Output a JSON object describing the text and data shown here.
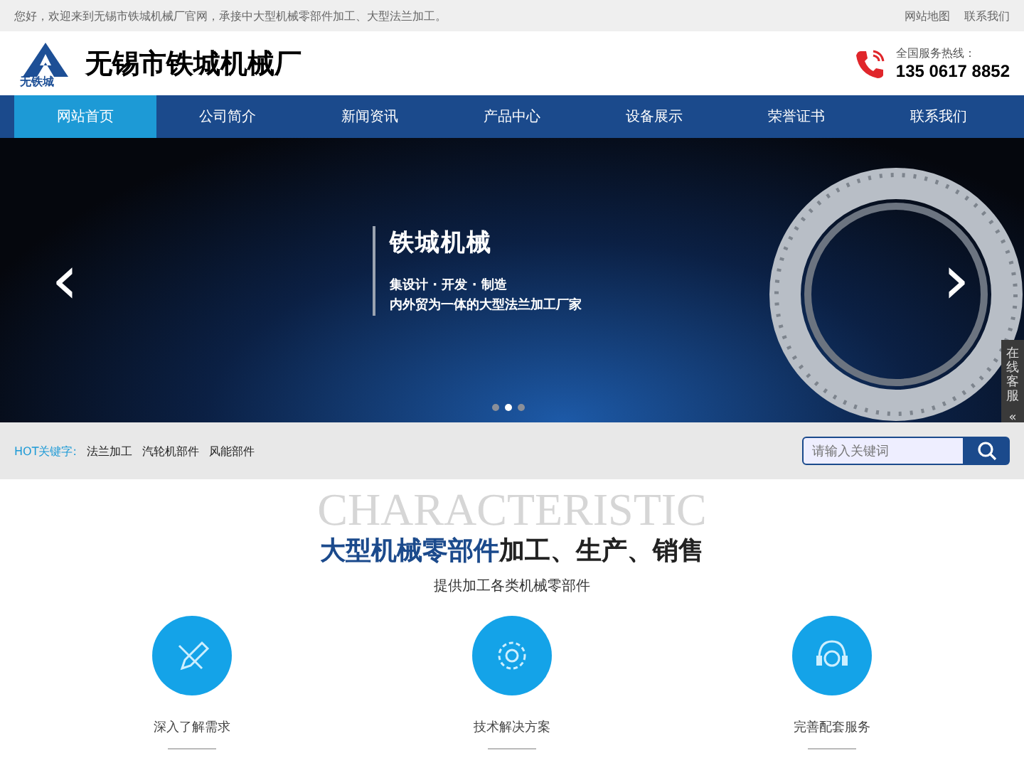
{
  "top_bar": {
    "welcome": "您好，欢迎来到无锡市铁城机械厂官网，承接中大型机械零部件加工、大型法兰加工。",
    "links": [
      "网站地图",
      "联系我们"
    ]
  },
  "header": {
    "logo_text": "无铁城",
    "company": "无锡市铁城机械厂",
    "hotline_label": "全国服务热线：",
    "hotline": "135 0617 8852"
  },
  "nav": [
    {
      "label": "网站首页",
      "selected": true
    },
    {
      "label": "公司简介",
      "selected": false
    },
    {
      "label": "新闻资讯",
      "selected": false
    },
    {
      "label": "产品中心",
      "selected": false
    },
    {
      "label": "设备展示",
      "selected": false
    },
    {
      "label": "荣誉证书",
      "selected": false
    },
    {
      "label": "联系我们",
      "selected": false
    }
  ],
  "banner": {
    "title": "铁城机械",
    "line1": "集设计 · 开发 · 制造",
    "line2": "内外贸为一体的大型法兰加工厂家",
    "prev": "‹",
    "next": "›",
    "dots": [
      {
        "selected": false
      },
      {
        "selected": true
      },
      {
        "selected": false
      }
    ]
  },
  "side_service": {
    "label": "在线客服",
    "arrow": "«"
  },
  "hot_bar": {
    "label": "HOT关键字:",
    "keywords": [
      "法兰加工",
      "汽轮机部件",
      "风能部件"
    ],
    "search": {
      "placeholder": "请输入关键词"
    }
  },
  "section": {
    "bg_word": "CHARACTERISTIC",
    "title_highlight": "大型机械零部件",
    "title_rest": "加工、生产、销售",
    "subtitle": "提供加工各类机械零部件",
    "features": [
      {
        "kind": "pencil",
        "label": "深入了解需求"
      },
      {
        "kind": "gear",
        "label": "技术解决方案"
      },
      {
        "kind": "headset",
        "label": "完善配套服务"
      }
    ]
  }
}
